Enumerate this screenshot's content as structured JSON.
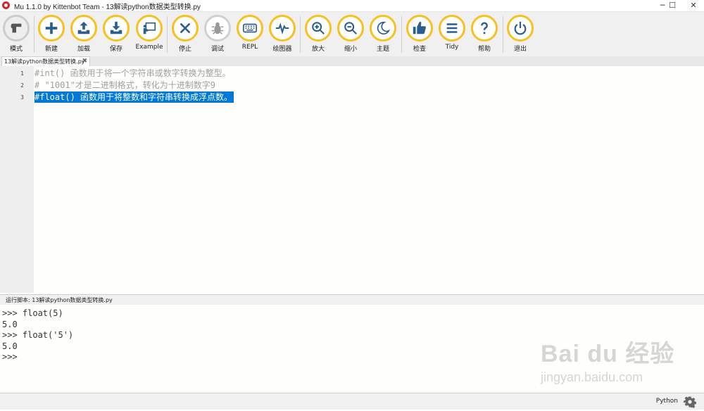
{
  "window": {
    "title": "Mu 1.1.0 by Kittenbot Team - 13解读python数据类型转换.py",
    "minimize_label": "─",
    "maximize_label": "☐",
    "close_label": "✕"
  },
  "toolbar": {
    "buttons": [
      {
        "label": "模式",
        "icon": "mode-icon"
      },
      {
        "label": "新建",
        "icon": "plus-icon"
      },
      {
        "label": "加载",
        "icon": "upload-icon"
      },
      {
        "label": "保存",
        "icon": "download-icon"
      },
      {
        "label": "Example",
        "icon": "presenter-icon"
      },
      {
        "label": "停止",
        "icon": "close-icon"
      },
      {
        "label": "调试",
        "icon": "bug-icon"
      },
      {
        "label": "REPL",
        "icon": "keyboard-icon"
      },
      {
        "label": "绘图器",
        "icon": "pulse-icon"
      },
      {
        "label": "放大",
        "icon": "zoom-in-icon"
      },
      {
        "label": "缩小",
        "icon": "zoom-out-icon"
      },
      {
        "label": "主题",
        "icon": "moon-icon"
      },
      {
        "label": "检查",
        "icon": "thumbs-up-icon"
      },
      {
        "label": "Tidy",
        "icon": "lines-icon"
      },
      {
        "label": "帮助",
        "icon": "question-icon"
      },
      {
        "label": "退出",
        "icon": "power-icon"
      }
    ],
    "accent_color": "#f7c11f"
  },
  "tab": {
    "label": "13解读python数据类型转换.py",
    "close_label": "✖"
  },
  "editor": {
    "lines": [
      {
        "number": "1",
        "text": "#int() 函数用于将一个字符串或数字转换为整型。"
      },
      {
        "number": "2",
        "text": "# \"1001\"才是二进制格式，转化为十进制数字9"
      },
      {
        "number": "3",
        "text": "#float() 函数用于将整数和字符串转换成浮点数。"
      }
    ],
    "selection_color": "#0078d7"
  },
  "repl": {
    "header": "运行脚本: 13解读python数据类型转换.py",
    "lines": [
      ">>> float(5)",
      "5.0",
      ">>> float('5')",
      "5.0",
      ">>> "
    ]
  },
  "status": {
    "mode": "Python"
  },
  "watermark": {
    "brand": "Bai du 经验",
    "url": "jingyan.baidu.com"
  }
}
